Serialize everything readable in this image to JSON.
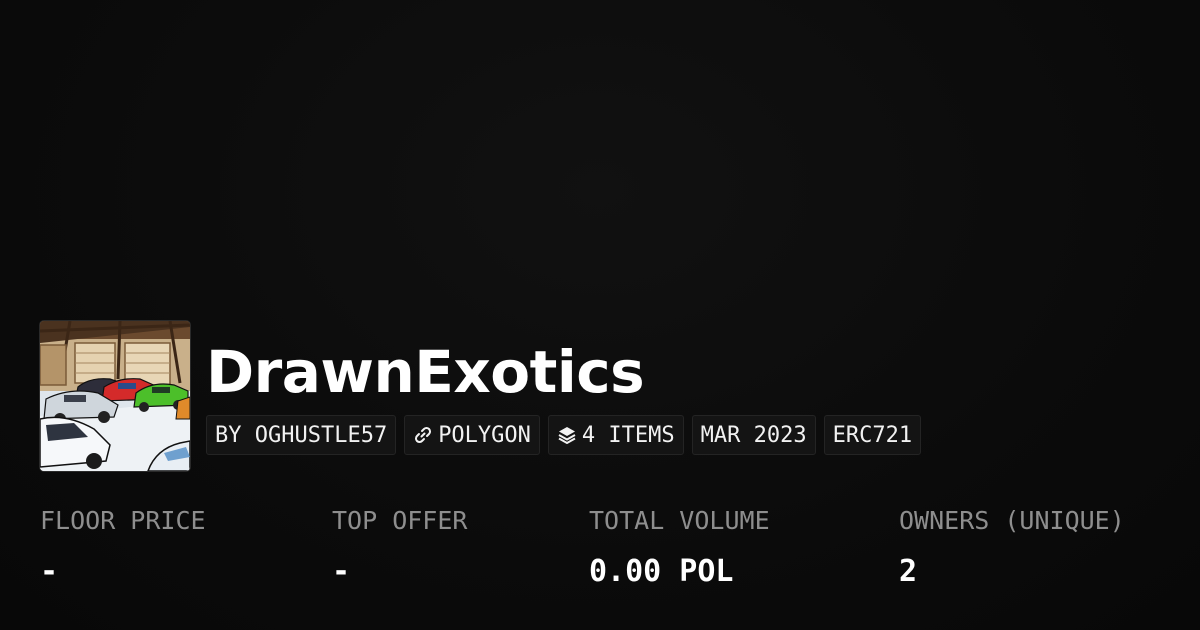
{
  "collection": {
    "title": "DrawnExotics",
    "avatar_icon": "collection-avatar-image"
  },
  "tags": {
    "creator": "BY OGHUSTLE57",
    "chain": "POLYGON",
    "chain_icon": "link-icon",
    "items": "4 ITEMS",
    "items_icon": "layers-icon",
    "date": "MAR 2023",
    "standard": "ERC721"
  },
  "stats": {
    "floor_price": {
      "label": "FLOOR PRICE",
      "value": "-"
    },
    "top_offer": {
      "label": "TOP OFFER",
      "value": "-"
    },
    "total_volume": {
      "label": "TOTAL VOLUME",
      "value": "0.00 POL"
    },
    "owners": {
      "label": "OWNERS (UNIQUE)",
      "value": "2"
    }
  },
  "colors": {
    "background": "#0b0b0b",
    "tag_background": "#141414",
    "label": "#8e8e8e",
    "text": "#ffffff"
  }
}
